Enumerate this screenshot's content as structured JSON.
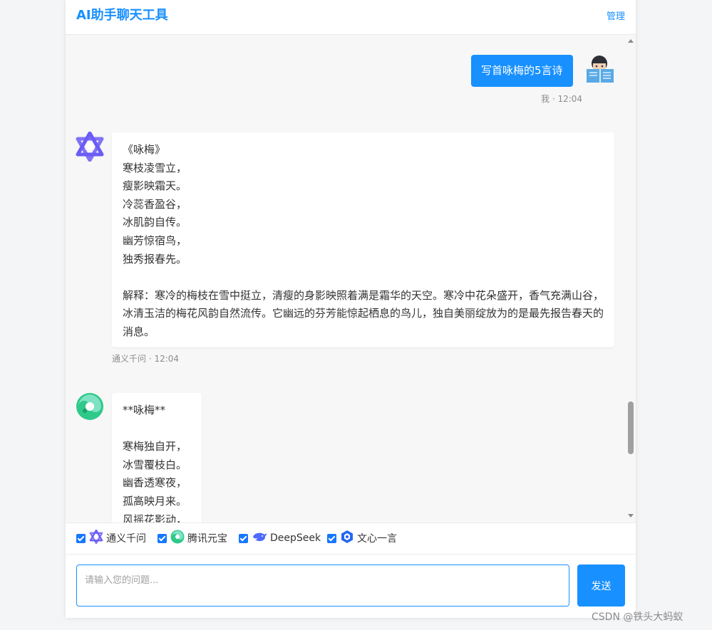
{
  "header": {
    "title": "AI助手聊天工具",
    "manage_label": "管理"
  },
  "messages": [
    {
      "role": "user",
      "text": "写首咏梅的5言诗",
      "meta": "我 · 12:04"
    },
    {
      "role": "assistant",
      "model_icon": "qwen-icon",
      "lines": [
        "《咏梅》",
        "寒枝凌雪立，",
        "瘦影映霜天。",
        "冷蕊香盈谷，",
        "冰肌韵自传。",
        "幽芳惊宿鸟，",
        "独秀报春先。",
        "",
        "解释：寒冷的梅枝在雪中挺立，清瘦的身影映照着满是霜华的天空。寒冷中花朵盛开，香气充满山谷，冰清玉洁的梅花风韵自然流传。它幽远的芬芳能惊起栖息的鸟儿，独自美丽绽放为的是最先报告春天的消息。"
      ],
      "meta": "通义千问 · 12:04"
    },
    {
      "role": "assistant",
      "model_icon": "yuanbao-icon",
      "lines": [
        "**咏梅**",
        "",
        "寒梅独自开，",
        "冰雪覆枝白。",
        "幽香透寒夜，",
        "孤高映月来。",
        "风摇花影动，"
      ]
    }
  ],
  "models": [
    {
      "label": "通义千问",
      "checked": true,
      "icon": "qwen-icon"
    },
    {
      "label": "腾讯元宝",
      "checked": true,
      "icon": "yuanbao-icon"
    },
    {
      "label": "DeepSeek",
      "checked": true,
      "icon": "deepseek-icon"
    },
    {
      "label": "文心一言",
      "checked": true,
      "icon": "wenxin-icon"
    }
  ],
  "input": {
    "placeholder": "请输入您的问题...",
    "value": ""
  },
  "send_label": "发送",
  "watermark": "CSDN @铁头大蚂蚁",
  "colors": {
    "accent": "#1890ff",
    "background": "#f7f7f7"
  }
}
